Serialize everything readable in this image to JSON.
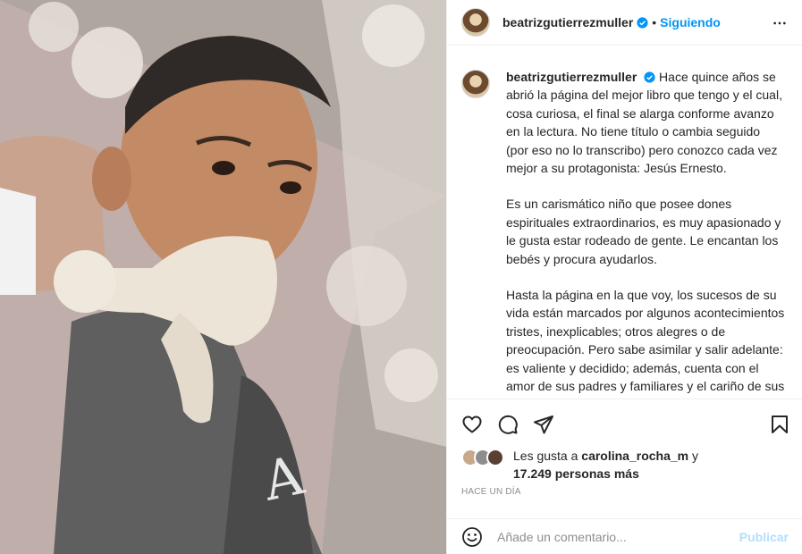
{
  "post": {
    "username": "beatrizgutierrezmuller",
    "follow_status": "Siguiendo",
    "dot": "•",
    "caption": {
      "p1": "Hace quince años se abrió la página del mejor libro que tengo y el cual, cosa curiosa, el final se alarga conforme avanzo en la lectura. No tiene título o cambia seguido (por eso no lo transcribo) pero conozco cada vez mejor a su protagonista: Jesús Ernesto.",
      "p2": "Es un carismático niño que posee dones espirituales extraordinarios, es muy apasionado y le gusta estar rodeado de gente. Le encantan los bebés y procura ayudarlos.",
      "p3": "Hasta la página en la que voy, los sucesos de su vida están marcados por algunos acontecimientos tristes, inexplicables; otros alegres o de preocupación. Pero sabe asimilar y salir adelante: es valiente y decidido; además, cuenta con el amor de sus padres y familiares y el cariño de sus múltiples amigos y maestros de edades variopintas que le comparten sus saberes, le corrigen cuando es necesario y le dan tips para sortear obstáculos o inconvenientes."
    },
    "likes": {
      "prefix": "Les gusta a",
      "liker": "carolina_rocha_m",
      "connector": "y",
      "count_text": "17.249 personas más"
    },
    "timestamp": "Hace un día",
    "comment": {
      "placeholder": "Añade un comentario...",
      "publish_label": "Publicar"
    }
  },
  "icons": {
    "verified": "verified-badge-icon",
    "more": "more-options-icon",
    "like": "heart-icon",
    "comment": "comment-icon",
    "share": "share-icon",
    "save": "bookmark-icon",
    "emoji": "emoji-icon"
  },
  "colors": {
    "accent": "#0095f6",
    "publish_disabled": "#b2dffc",
    "muted": "#8e8e8e",
    "text": "#262626"
  }
}
